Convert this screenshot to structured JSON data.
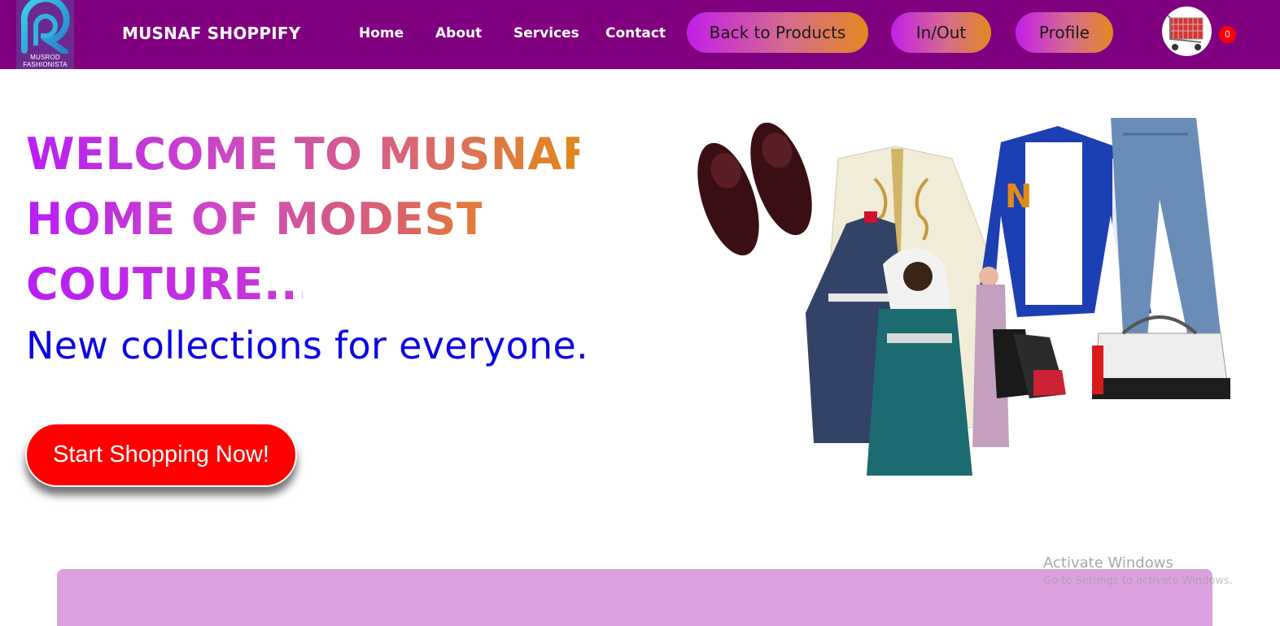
{
  "header": {
    "logo": {
      "line1": "MUSROD",
      "line2": "FASHIONISTA",
      "icon": "R-logo-icon"
    },
    "brand": "MUSNAF SHOPPIFY",
    "nav": [
      {
        "label": "Home"
      },
      {
        "label": "About"
      },
      {
        "label": "Services"
      },
      {
        "label": "Contact"
      }
    ],
    "buttons": {
      "back_to_products": "Back to Products",
      "in_out": "In/Out",
      "profile": "Profile"
    },
    "cart": {
      "icon": "shopping-cart-icon",
      "count": "0"
    }
  },
  "hero": {
    "title_lines": [
      "WELCOME TO MUSNAF",
      "HOME OF MODEST",
      "COUTURE..."
    ],
    "subtitle": "New collections for everyone.",
    "cta_label": "Start Shopping Now!",
    "image_alt": "fashion-collection-image"
  },
  "watermark": {
    "title": "Activate Windows",
    "subtitle": "Go to Settings to activate Windows."
  },
  "colors": {
    "nav_bg": "#800080",
    "pill_gradient": [
      "#c21fe8",
      "#e2881e"
    ],
    "cta_bg": "#ff0000",
    "subtitle": "#0a00e6",
    "panel_bg": "#dba1df",
    "badge": "#ff0000"
  }
}
